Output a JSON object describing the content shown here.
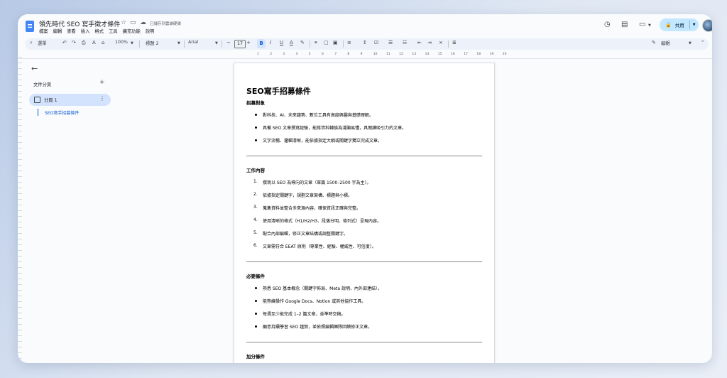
{
  "header": {
    "doc_title": "領先時代 SEO 寫手徵才條件",
    "saved_status": "已儲存到雲端硬碟",
    "menu": [
      "檔案",
      "編輯",
      "查看",
      "插入",
      "格式",
      "工具",
      "擴充功能",
      "說明"
    ],
    "share_label": "共用"
  },
  "toolbar": {
    "search_label": "選單",
    "zoom": "100%",
    "style": "標題 2",
    "font": "Arial",
    "font_size": "17",
    "bold": "B",
    "italic": "I",
    "underline": "U",
    "text_color": "A",
    "edit_mode": "編輯",
    "minus": "−",
    "plus": "+"
  },
  "ruler": [
    "1",
    "2",
    "3",
    "4",
    "5",
    "6",
    "7",
    "8",
    "9",
    "10",
    "11",
    "12",
    "13",
    "14",
    "15",
    "16",
    "17",
    "18",
    "19",
    "20"
  ],
  "sidebar": {
    "title": "文件分頁",
    "tab_label": "分頁 1",
    "outline_heading": "SEO寫手招募條件"
  },
  "document": {
    "title": "SEO寫手招募條件",
    "sections": [
      {
        "heading": "招募對象",
        "type": "bullet",
        "items": [
          "對科技、AI、未來趨勢、數位工具有高度興趣與基礎理解。",
          "具備 SEO 文章撰寫經驗，能將資料轉換為淺顯易懂，具閱讀吸引力的文章。",
          "文字流暢、邏輯清晰，能依據指定大綱或關鍵字獨立完成文章。"
        ]
      },
      {
        "heading": "工作內容",
        "type": "number",
        "items": [
          "撰寫以 SEO 為導向的文章（單篇 1500–2500 字為主）。",
          "依據指定關鍵字，規劃文章架構、標題與小標。",
          "蒐集資料並整合多來源內容，確保資訊正確與完整。",
          "使用清晰的格式（H1/H2/H3、段落分明、條列式）呈現內容。",
          "配合內部編輯，修正文章結構或調整關鍵字。",
          "文章需符合 EEAT 原則（專業性、經驗、權威性、可信度）。"
        ]
      },
      {
        "heading": "必要條件",
        "type": "bullet",
        "items": [
          "熟悉 SEO 基本概念（關鍵字佈局、Meta 說明、內外部連結）。",
          "能熟練操作 Google Docs、Notion 或其他協作工具。",
          "每週至少能完成 1–2 篇文章，並準時交稿。",
          "願意持續學習 SEO 趨勢，並依照編輯團隊回饋修正文章。"
        ]
      },
      {
        "heading": "加分條件",
        "type": "bullet",
        "items": []
      }
    ]
  }
}
